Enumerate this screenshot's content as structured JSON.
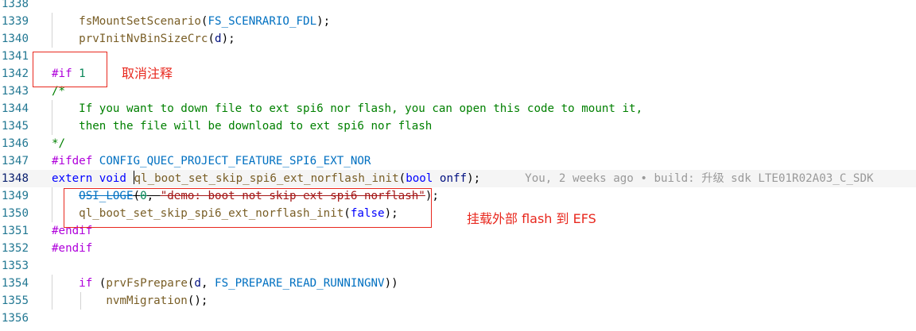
{
  "editor": {
    "lines": [
      {
        "number": "1338",
        "tokens": []
      },
      {
        "number": "1339",
        "tokens": [
          {
            "text": "    ",
            "cls": ""
          },
          {
            "text": "fsMountSetScenario",
            "cls": "fn"
          },
          {
            "text": "(",
            "cls": "pun"
          },
          {
            "text": "FS_SCENRARIO_FDL",
            "cls": "const"
          },
          {
            "text": ");",
            "cls": "pun"
          }
        ]
      },
      {
        "number": "1340",
        "tokens": [
          {
            "text": "    ",
            "cls": ""
          },
          {
            "text": "prvInitNvBinSizeCrc",
            "cls": "fn"
          },
          {
            "text": "(",
            "cls": "pun"
          },
          {
            "text": "d",
            "cls": "id"
          },
          {
            "text": ");",
            "cls": "pun"
          }
        ]
      },
      {
        "number": "1341",
        "tokens": []
      },
      {
        "number": "1342",
        "tokens": [
          {
            "text": "#if",
            "cls": "pp"
          },
          {
            "text": " ",
            "cls": ""
          },
          {
            "text": "1",
            "cls": "num"
          }
        ]
      },
      {
        "number": "1343",
        "tokens": [
          {
            "text": "/*",
            "cls": "com"
          }
        ]
      },
      {
        "number": "1344",
        "tokens": [
          {
            "text": "    If you want to down file to ext spi6 nor flash, you can open this code to mount it,",
            "cls": "com"
          }
        ]
      },
      {
        "number": "1345",
        "tokens": [
          {
            "text": "    then the file will be download to ext spi6 nor flash",
            "cls": "com"
          }
        ]
      },
      {
        "number": "1346",
        "tokens": [
          {
            "text": "*/",
            "cls": "com"
          }
        ]
      },
      {
        "number": "1347",
        "tokens": [
          {
            "text": "#ifdef",
            "cls": "pp"
          },
          {
            "text": " ",
            "cls": ""
          },
          {
            "text": "CONFIG_QUEC_PROJECT_FEATURE_SPI6_EXT_NOR",
            "cls": "macro"
          }
        ]
      },
      {
        "number": "1348",
        "current": true,
        "tokens": [
          {
            "text": "extern",
            "cls": "kw"
          },
          {
            "text": " ",
            "cls": ""
          },
          {
            "text": "void",
            "cls": "kw"
          },
          {
            "text": " ",
            "cls": ""
          },
          {
            "text": "",
            "cls": "cursor"
          },
          {
            "text": "ql_boot_set_skip_spi6_ext_norflash_init",
            "cls": "fn"
          },
          {
            "text": "(",
            "cls": "pun"
          },
          {
            "text": "bool",
            "cls": "kw"
          },
          {
            "text": " ",
            "cls": ""
          },
          {
            "text": "onff",
            "cls": "id"
          },
          {
            "text": ");",
            "cls": "pun"
          }
        ]
      },
      {
        "number": "1349",
        "tokens": [
          {
            "text": "    ",
            "cls": ""
          },
          {
            "text": "OSI_LOGE",
            "cls": "macro strike"
          },
          {
            "text": "(",
            "cls": "pun strike"
          },
          {
            "text": "0",
            "cls": "num strike"
          },
          {
            "text": ", ",
            "cls": "pun strike"
          },
          {
            "text": "\"demo: boot not skip ext spi6 norflash\"",
            "cls": "str strike"
          },
          {
            "text": ");",
            "cls": "pun"
          }
        ]
      },
      {
        "number": "1350",
        "tokens": [
          {
            "text": "    ",
            "cls": ""
          },
          {
            "text": "ql_boot_set_skip_spi6_ext_norflash_init",
            "cls": "fn"
          },
          {
            "text": "(",
            "cls": "pun"
          },
          {
            "text": "false",
            "cls": "kw"
          },
          {
            "text": ");",
            "cls": "pun"
          }
        ]
      },
      {
        "number": "1351",
        "tokens": [
          {
            "text": "#endif",
            "cls": "pp"
          }
        ]
      },
      {
        "number": "1352",
        "tokens": [
          {
            "text": "#endif",
            "cls": "pp"
          }
        ]
      },
      {
        "number": "1353",
        "tokens": []
      },
      {
        "number": "1354",
        "tokens": [
          {
            "text": "    ",
            "cls": ""
          },
          {
            "text": "if",
            "cls": "pp"
          },
          {
            "text": " (",
            "cls": "pun"
          },
          {
            "text": "prvFsPrepare",
            "cls": "fn"
          },
          {
            "text": "(",
            "cls": "pun"
          },
          {
            "text": "d",
            "cls": "id"
          },
          {
            "text": ", ",
            "cls": "pun"
          },
          {
            "text": "FS_PREPARE_READ_RUNNINGNV",
            "cls": "const"
          },
          {
            "text": "))",
            "cls": "pun"
          }
        ]
      },
      {
        "number": "1355",
        "tokens": [
          {
            "text": "        ",
            "cls": ""
          },
          {
            "text": "nvmMigration",
            "cls": "fn"
          },
          {
            "text": "();",
            "cls": "pun"
          }
        ]
      },
      {
        "number": "1356",
        "tokens": []
      }
    ],
    "blame": "You, 2 weeks ago • build: 升级 sdk LTE01R02A03_C_SDK"
  },
  "annotations": {
    "uncomment_label": "取消注释",
    "mount_label": "挂载外部 flash 到 EFS",
    "color": "#e8281e"
  }
}
